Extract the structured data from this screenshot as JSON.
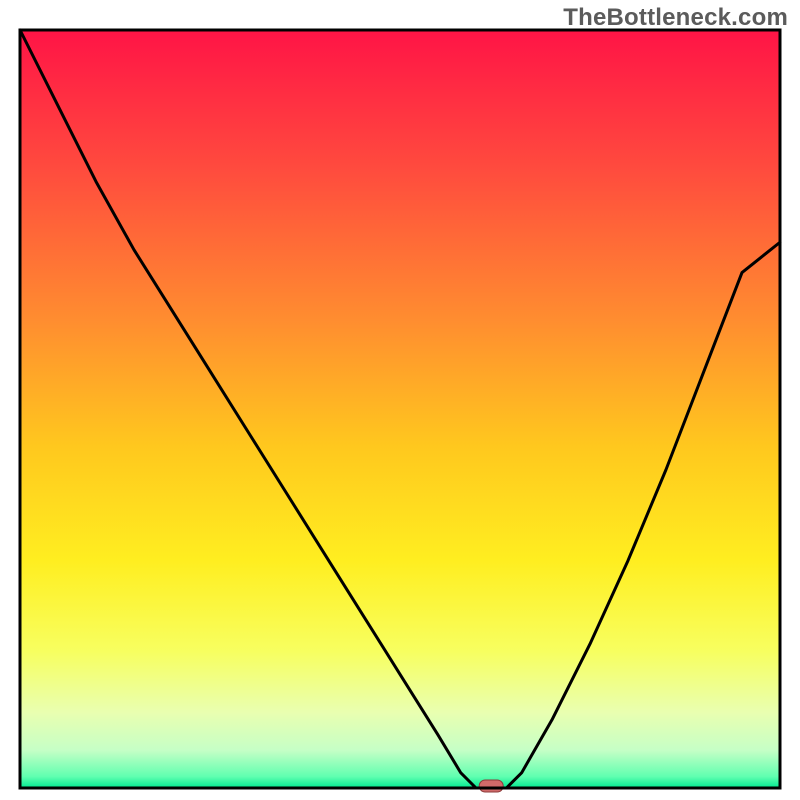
{
  "watermark": "TheBottleneck.com",
  "chart_data": {
    "type": "line",
    "title": "",
    "xlabel": "",
    "ylabel": "",
    "xlim": [
      0,
      100
    ],
    "ylim": [
      0,
      100
    ],
    "x": [
      0,
      5,
      10,
      15,
      20,
      25,
      30,
      35,
      40,
      45,
      50,
      55,
      58,
      60,
      62,
      64,
      66,
      70,
      75,
      80,
      85,
      90,
      95,
      100
    ],
    "values": [
      100,
      90,
      80,
      71,
      63,
      55,
      47,
      39,
      31,
      23,
      15,
      7,
      2,
      0,
      0,
      0,
      2,
      9,
      19,
      30,
      42,
      55,
      68,
      72
    ],
    "marker": {
      "x": 62,
      "y": 0
    },
    "grid": false,
    "legend": false,
    "background": "vertical-rainbow-gradient",
    "colors": {
      "gradient_stops": [
        {
          "offset": 0.0,
          "color": "#ff1446"
        },
        {
          "offset": 0.18,
          "color": "#ff4a3e"
        },
        {
          "offset": 0.38,
          "color": "#ff8c30"
        },
        {
          "offset": 0.55,
          "color": "#ffc81e"
        },
        {
          "offset": 0.7,
          "color": "#ffee20"
        },
        {
          "offset": 0.82,
          "color": "#f7ff60"
        },
        {
          "offset": 0.9,
          "color": "#e9ffb0"
        },
        {
          "offset": 0.95,
          "color": "#c6ffc6"
        },
        {
          "offset": 0.985,
          "color": "#60ffb0"
        },
        {
          "offset": 1.0,
          "color": "#00e890"
        }
      ],
      "line": "#000000",
      "marker_fill": "#d06a6a",
      "marker_stroke": "#8e3a3a",
      "border": "#000000"
    }
  }
}
